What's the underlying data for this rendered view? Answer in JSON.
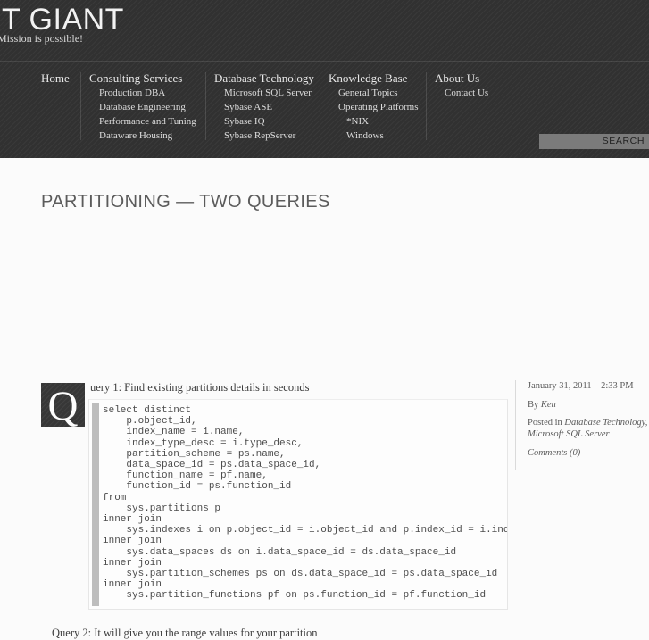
{
  "header": {
    "site_title": "IT GIANT",
    "tagline": "Mission is possible!"
  },
  "nav": {
    "columns": [
      {
        "top": "Home",
        "items": []
      },
      {
        "top": "Consulting Services",
        "items": [
          "Production DBA",
          "Database Engineering",
          "Performance and Tuning",
          "Dataware Housing"
        ]
      },
      {
        "top": "Database Technology",
        "items": [
          "Microsoft SQL Server",
          "Sybase ASE",
          "Sybase IQ",
          "Sybase RepServer"
        ]
      },
      {
        "top": "Knowledge Base",
        "items": [
          "General Topics",
          "Operating Platforms",
          "*NIX",
          "Windows"
        ]
      },
      {
        "top": "About Us",
        "items": [
          "Contact Us"
        ]
      }
    ]
  },
  "search": {
    "placeholder": "SEARCH",
    "value": ""
  },
  "article": {
    "title": "PARTITIONING — TWO QUERIES",
    "dropcap": "Q",
    "intro": "uery 1: Find existing partitions details in seconds",
    "code": "select distinct\n    p.object_id,\n    index_name = i.name,\n    index_type_desc = i.type_desc,\n    partition_scheme = ps.name,\n    data_space_id = ps.data_space_id,\n    function_name = pf.name,\n    function_id = ps.function_id\nfrom\n    sys.partitions p\ninner join\n    sys.indexes i on p.object_id = i.object_id and p.index_id = i.index_id\ninner join\n    sys.data_spaces ds on i.data_space_id = ds.data_space_id\ninner join\n    sys.partition_schemes ps on ds.data_space_id = ps.data_space_id\ninner join\n    sys.partition_functions pf on ps.function_id = pf.function_id",
    "closing": "Query 2: It will give you the range values for your partition"
  },
  "meta": {
    "date": "January 31, 2011 – 2:33 PM",
    "author_prefix": "By ",
    "author": "Ken",
    "posted_prefix": "Posted in ",
    "categories": "Database Technology, Microsoft SQL Server",
    "comments": "Comments (0)"
  },
  "colors": {
    "header_bg": "#333333",
    "content_bg": "#fbfbfb",
    "title_text": "#5b5b5b",
    "code_text": "#4c4c4c",
    "search_bg": "#7b7b7b"
  }
}
